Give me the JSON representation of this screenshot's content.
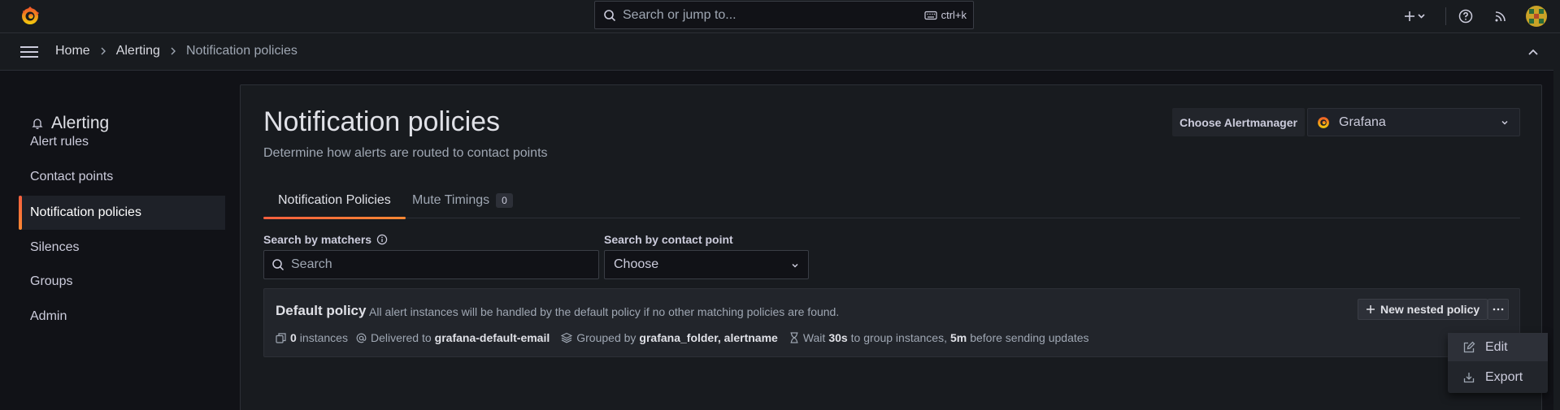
{
  "topbar": {
    "search_placeholder": "Search or jump to...",
    "search_shortcut": "ctrl+k",
    "icons": [
      "grafana-logo-icon",
      "search-icon",
      "keyboard-icon",
      "plus-icon",
      "chevron-down-icon",
      "help-icon",
      "rss-icon",
      "avatar"
    ]
  },
  "breadcrumb": {
    "items": [
      "Home",
      "Alerting",
      "Notification policies"
    ]
  },
  "sidebar": {
    "title": "Alerting",
    "items": [
      {
        "label": "Alert rules",
        "active": false
      },
      {
        "label": "Contact points",
        "active": false
      },
      {
        "label": "Notification policies",
        "active": true
      },
      {
        "label": "Silences",
        "active": false
      },
      {
        "label": "Groups",
        "active": false
      },
      {
        "label": "Admin",
        "active": false
      }
    ]
  },
  "page": {
    "title": "Notification policies",
    "subtitle": "Determine how alerts are routed to contact points"
  },
  "alertmanager": {
    "label": "Choose Alertmanager",
    "value": "Grafana"
  },
  "tabs": [
    {
      "label": "Notification Policies",
      "active": true
    },
    {
      "label": "Mute Timings",
      "count": "0",
      "active": false
    }
  ],
  "filters": {
    "matchers_label": "Search by matchers",
    "matchers_placeholder": "Search",
    "contact_label": "Search by contact point",
    "contact_value": "Choose"
  },
  "policy": {
    "name": "Default policy",
    "description": "All alert instances will be handled by the default policy if no other matching policies are found.",
    "instances_count": "0",
    "instances_label": "instances",
    "delivered_label": "Delivered to",
    "contact_point": "grafana-default-email",
    "grouped_label": "Grouped by",
    "group_by": "grafana_folder, alertname",
    "wait_label": "Wait",
    "group_wait": "30s",
    "group_wait_suffix": "to group instances,",
    "group_interval": "5m",
    "group_interval_suffix": "before sending updates",
    "new_nested_label": "New nested policy",
    "more_label": "···"
  },
  "menu": {
    "items": [
      "Edit",
      "Export"
    ]
  },
  "colors": {
    "accent_start": "#f55f3e",
    "accent_end": "#ff8833",
    "background": "#111217",
    "panel": "#181b1f"
  }
}
